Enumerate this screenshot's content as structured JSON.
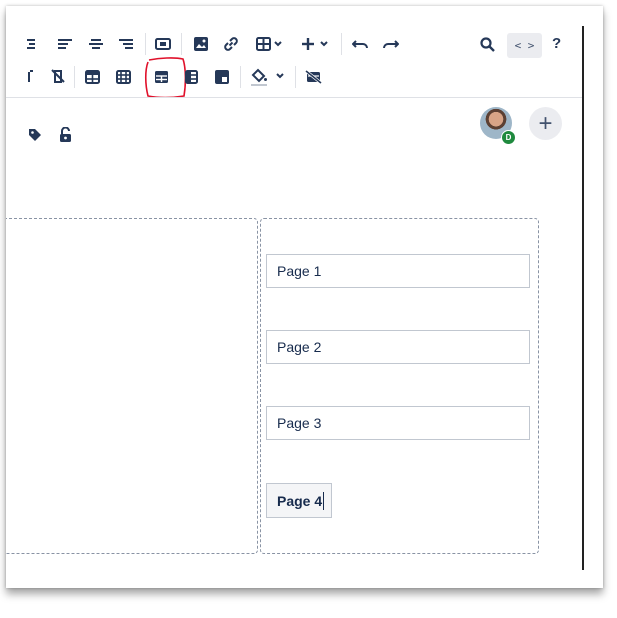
{
  "toolbar_row1": {
    "icons": [
      "list-icon",
      "align-left-icon",
      "align-center-icon",
      "align-right-icon",
      "layout-icon",
      "image-icon",
      "link-icon",
      "table-icon",
      "insert-icon",
      "undo-icon",
      "redo-icon",
      "search-icon"
    ],
    "code_label": "< >",
    "help_label": "?"
  },
  "toolbar_row2": {
    "icons": [
      "row-insert-icon",
      "column-delete-icon",
      "table-row-header-icon",
      "table-column-header-icon",
      "table-merge-icon",
      "table-split-icon",
      "cell-background-icon",
      "paint-bucket-icon",
      "table-delete-icon"
    ],
    "highlight_color": "#e0112b"
  },
  "meta_bar": {
    "avatar_badge": "D",
    "add_label": "+"
  },
  "content": {
    "fields": [
      {
        "value": "Page 1"
      },
      {
        "value": "Page 2"
      },
      {
        "value": "Page 3"
      },
      {
        "value": "Page 4"
      }
    ]
  }
}
